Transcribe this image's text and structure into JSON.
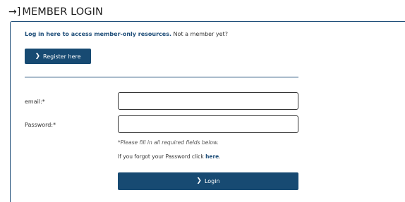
{
  "heading": {
    "icon": "login-arrow-icon",
    "icon_glyph": "→]",
    "title": "MEMBER LOGIN"
  },
  "intro": {
    "prefix": "Log in here to access ",
    "link": "member-only resources.",
    "suffix": " Not a member yet?"
  },
  "register_button": {
    "icon_glyph": "❯",
    "label": "Register here"
  },
  "form": {
    "email_label": "email:*",
    "email_value": "",
    "password_label": "Password:*",
    "password_value": "",
    "required_note": "*Please fill in all required fields below.",
    "forgot_prefix": "If you forgot your Password click ",
    "forgot_link": "here",
    "forgot_suffix": "."
  },
  "login_button": {
    "icon_glyph": "❯",
    "label": "Login"
  },
  "colors": {
    "accent": "#174a72",
    "border": "#1f4e79"
  }
}
